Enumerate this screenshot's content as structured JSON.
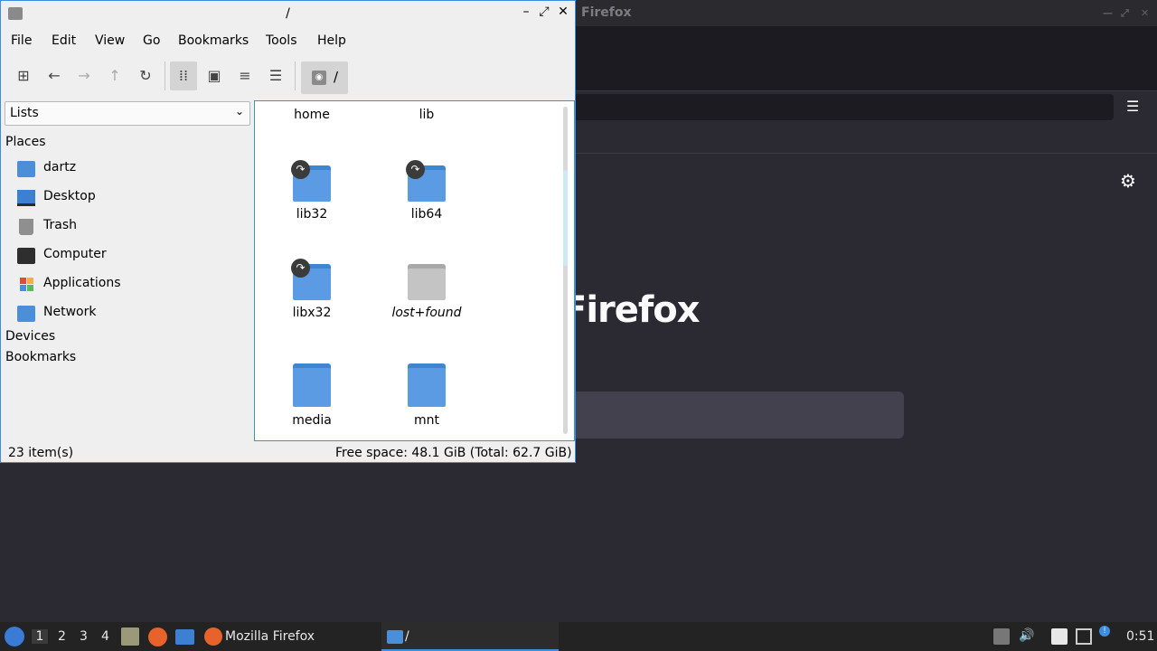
{
  "firefox": {
    "title": "Firefox",
    "logo_text": "Firefox",
    "menu_icon": "hamburger-menu-icon",
    "settings_icon": "gear-icon"
  },
  "file_manager": {
    "title": "/",
    "menu": [
      "File",
      "Edit",
      "View",
      "Go",
      "Bookmarks",
      "Tools",
      "Help"
    ],
    "toolbar": {
      "icons": [
        "new-tab-icon",
        "back-arrow-icon",
        "forward-arrow-icon",
        "up-arrow-icon",
        "reload-icon",
        "icon-view-icon",
        "thumbnail-view-icon",
        "compact-view-icon",
        "detailed-list-icon"
      ],
      "path": "/"
    },
    "side_pane": {
      "mode": "Lists",
      "places_header": "Places",
      "places": [
        "dartz",
        "Desktop",
        "Trash",
        "Computer",
        "Applications",
        "Network"
      ],
      "devices_header": "Devices",
      "bookmarks_header": "Bookmarks"
    },
    "items": [
      {
        "name": "home",
        "type": "folder"
      },
      {
        "name": "lib",
        "type": "folder"
      },
      {
        "name": "lib32",
        "type": "folder-link"
      },
      {
        "name": "lib64",
        "type": "folder-link"
      },
      {
        "name": "libx32",
        "type": "folder-link"
      },
      {
        "name": "lost+found",
        "type": "folder-restricted"
      },
      {
        "name": "media",
        "type": "folder"
      },
      {
        "name": "mnt",
        "type": "folder"
      }
    ],
    "status": {
      "count": "23 item(s)",
      "free_space": "Free space: 48.1 GiB (Total: 62.7 GiB)"
    }
  },
  "taskbar": {
    "workspaces": [
      "1",
      "2",
      "3",
      "4"
    ],
    "tasks": [
      "Mozilla Firefox",
      "/"
    ],
    "clock": "0:51"
  }
}
